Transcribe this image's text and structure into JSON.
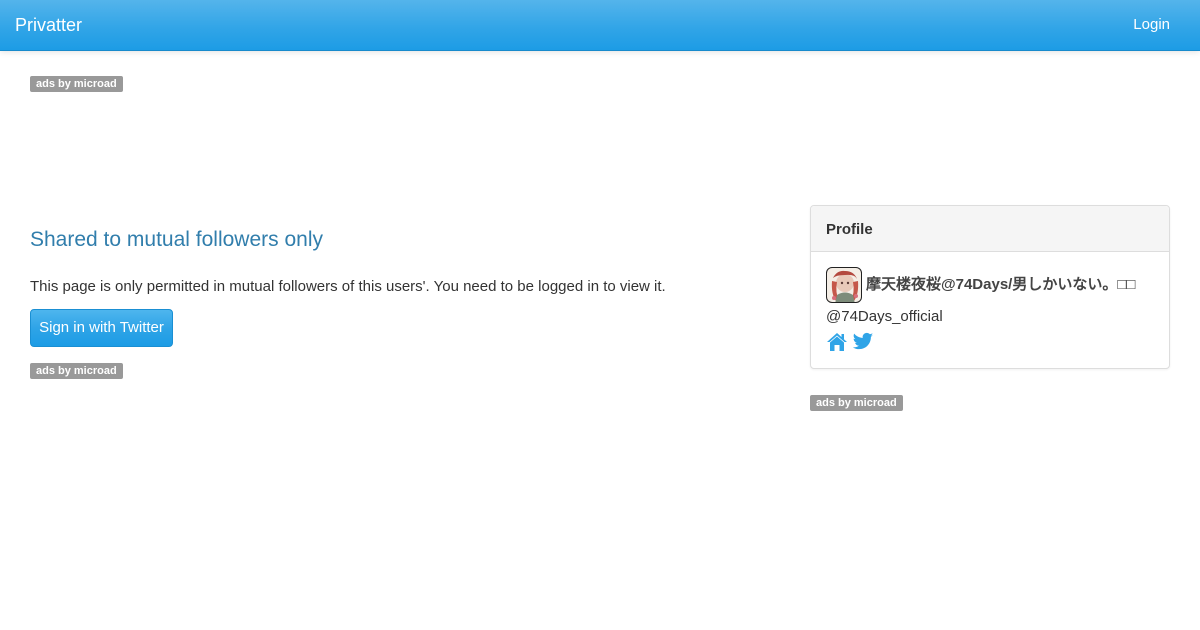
{
  "navbar": {
    "brand": "Privatter",
    "login_label": "Login",
    "color": "#2fa4e7"
  },
  "ads": {
    "label": "ads by microad"
  },
  "main": {
    "heading": "Shared to mutual followers only",
    "notice": "This page is only permitted in mutual followers of this users'. You need to be logged in to view it.",
    "button_label": "Sign in with Twitter"
  },
  "profile": {
    "panel_title": "Profile",
    "display_name": "摩天楼夜桜@74Days/男しかいない。□□",
    "screen_name": "@74Days_official",
    "icons": [
      "home-icon",
      "twitter-bird-icon"
    ],
    "icon_color": "#2fa4e7"
  }
}
